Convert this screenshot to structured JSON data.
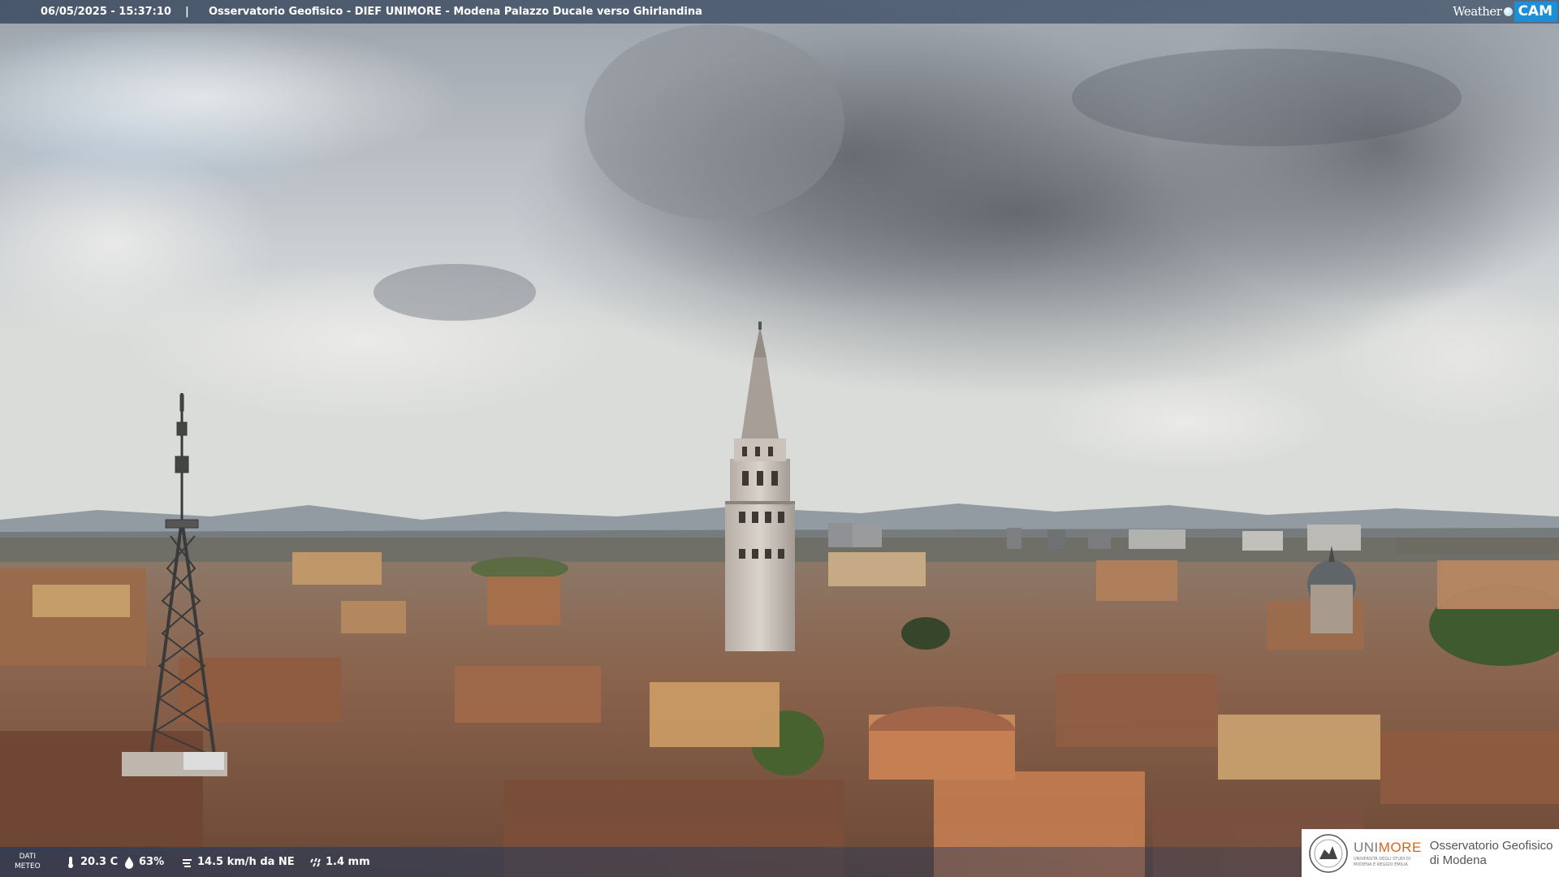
{
  "header": {
    "datetime": "06/05/2025 - 15:37:10",
    "separator": "|",
    "caption": "Osservatorio Geofisico - DIEF UNIMORE - Modena Palazzo Ducale verso Ghirlandina",
    "brand_weather": "Weather",
    "brand_cam": "CAM"
  },
  "meteo": {
    "label_line1": "DATI",
    "label_line2": "METEO",
    "temperature": "20.3 C",
    "humidity": "63%",
    "wind": "14.5 km/h da NE",
    "rain": "1.4 mm",
    "icons": [
      "thermometer-icon",
      "humidity-drop-icon",
      "wind-icon",
      "rain-icon"
    ]
  },
  "logo": {
    "name_uni": "UNI",
    "name_more": "MORE",
    "sub_line1": "UNIVERSITÀ DEGLI STUDI DI",
    "sub_line2": "MODENA E REGGIO EMILIA",
    "observatory_line1": "Osservatorio Geofisico",
    "observatory_line2": "di Modena"
  },
  "colors": {
    "cam_blue": "#1c8fd6",
    "unimore_orange": "#d9641e",
    "bar_blue": "#3c4a60"
  }
}
